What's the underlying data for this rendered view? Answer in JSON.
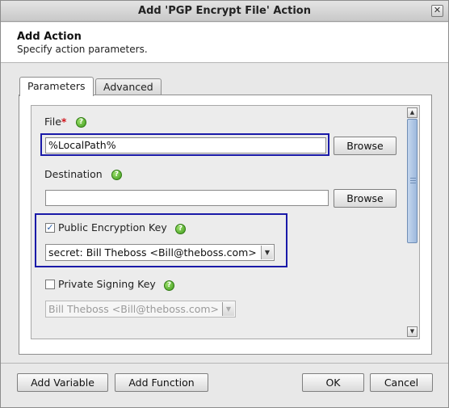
{
  "window": {
    "title": "Add 'PGP Encrypt File' Action",
    "close_glyph": "✕"
  },
  "header": {
    "title": "Add Action",
    "subtitle": "Specify action parameters."
  },
  "tabs": [
    {
      "label": "Parameters",
      "selected": true
    },
    {
      "label": "Advanced",
      "selected": false
    }
  ],
  "form": {
    "file": {
      "label": "File",
      "required_mark": "*",
      "value": "%LocalPath%",
      "browse_label": "Browse"
    },
    "destination": {
      "label": "Destination",
      "value": "",
      "browse_label": "Browse"
    },
    "public_key": {
      "label": "Public Encryption Key",
      "checked": true,
      "selected": "secret: Bill Theboss <Bill@theboss.com>"
    },
    "private_key": {
      "label": "Private Signing Key",
      "checked": false,
      "selected": "Bill Theboss <Bill@theboss.com>"
    },
    "help_glyph": "?",
    "check_glyph": "✓"
  },
  "footer": {
    "add_variable_label": "Add Variable",
    "add_function_label": "Add Function",
    "ok_label": "OK",
    "cancel_label": "Cancel"
  },
  "colors": {
    "highlight": "#1a1aa8",
    "required": "#d0141c",
    "help_icon": "#4aa624"
  },
  "icons": {
    "help": "help-icon",
    "close": "close-icon",
    "dropdown": "chevron-down-icon"
  }
}
